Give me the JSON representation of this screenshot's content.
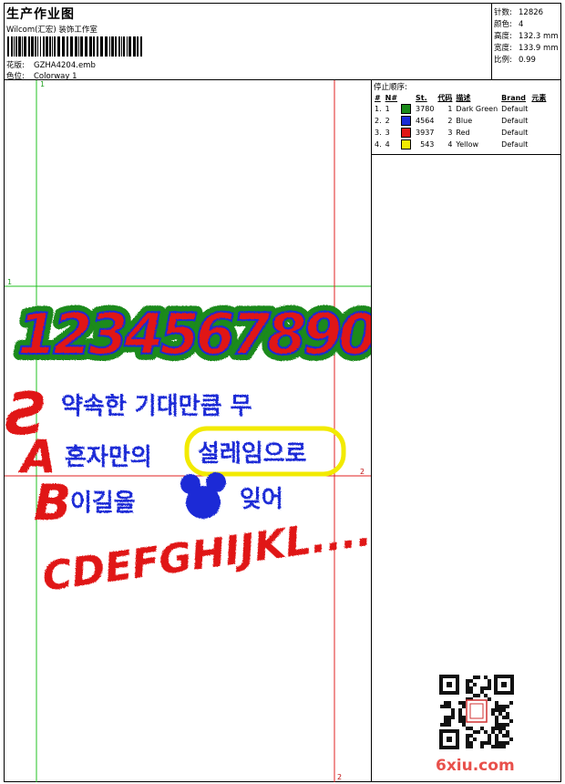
{
  "header": {
    "title": "生产作业图",
    "company": "Wilcom(汇宏) 装饰工作室",
    "design_label": "花版:",
    "design_value": "GZHA4204.emb",
    "colorway_label": "色位:",
    "colorway_value": "Colorway 1"
  },
  "stats": [
    {
      "label": "针数:",
      "value": "12826"
    },
    {
      "label": "颜色:",
      "value": "4"
    },
    {
      "label": "高度:",
      "value": "132.3 mm"
    },
    {
      "label": "宽度:",
      "value": "133.9 mm"
    },
    {
      "label": "比例:",
      "value": "0.99"
    }
  ],
  "stop_sequence": {
    "title": "停止顺序:",
    "columns": [
      "#",
      "N#",
      "St.",
      "代码",
      "描述",
      "Brand",
      "元素"
    ],
    "rows": [
      {
        "idx": "1.",
        "n": "1",
        "color": "#1a8a1a",
        "st": "3780",
        "code": "1",
        "desc": "Dark Green",
        "brand": "Default"
      },
      {
        "idx": "2.",
        "n": "2",
        "color": "#1a2bd6",
        "st": "4564",
        "code": "2",
        "desc": "Blue",
        "brand": "Default"
      },
      {
        "idx": "3.",
        "n": "3",
        "color": "#e01616",
        "st": "3937",
        "code": "3",
        "desc": "Red",
        "brand": "Default"
      },
      {
        "idx": "4.",
        "n": "4",
        "color": "#f2ea00",
        "st": "543",
        "code": "4",
        "desc": "Yellow",
        "brand": "Default"
      }
    ]
  },
  "design": {
    "guide_labels": {
      "top": "1",
      "left": "1",
      "right": "2",
      "bottom": "2"
    },
    "digits": "1234567890",
    "korean_line1": "약속한 기대만큼 무",
    "korean_line2a": "혼자만의",
    "korean_line2b": "설레임으로",
    "korean_line3a": "이길을",
    "korean_line3b": "잊어",
    "alphabet_abc": [
      "A",
      "B"
    ],
    "alphabet_row": "CDEFGHIJKL...."
  },
  "watermark": "6xiu.com",
  "colors": {
    "green": "#1a8a1a",
    "blue": "#1a2bd6",
    "red": "#e01616",
    "yellow": "#f2ea00",
    "guide_green": "#21c021",
    "guide_red": "#e02020"
  }
}
